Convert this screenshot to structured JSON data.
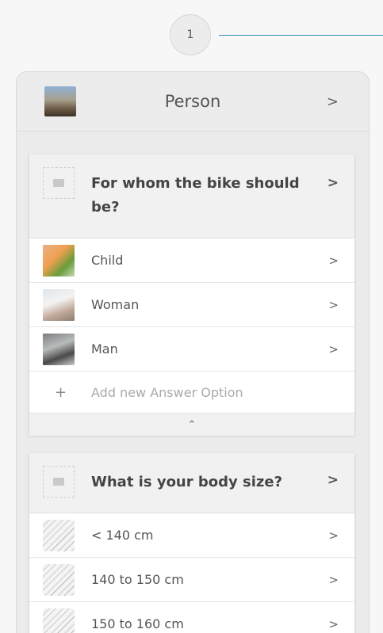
{
  "stepper": {
    "step_number": "1"
  },
  "panel": {
    "title": "Person"
  },
  "question1": {
    "title": "For whom the bike should be?",
    "options": [
      {
        "label": "Child"
      },
      {
        "label": "Woman"
      },
      {
        "label": "Man"
      }
    ],
    "add_label": "Add new Answer Option",
    "add_symbol": "+",
    "collapse_symbol": "≈"
  },
  "question2": {
    "title": "What is your body size?",
    "options": [
      {
        "label": "< 140 cm"
      },
      {
        "label": "140 to 150 cm"
      },
      {
        "label": "150 to 160 cm"
      }
    ]
  },
  "icons": {
    "chevron": "›",
    "collapse": "⌃⌃"
  },
  "colors": {
    "step_line": "#2f8fb5",
    "panel_bg": "#ebebeb"
  }
}
